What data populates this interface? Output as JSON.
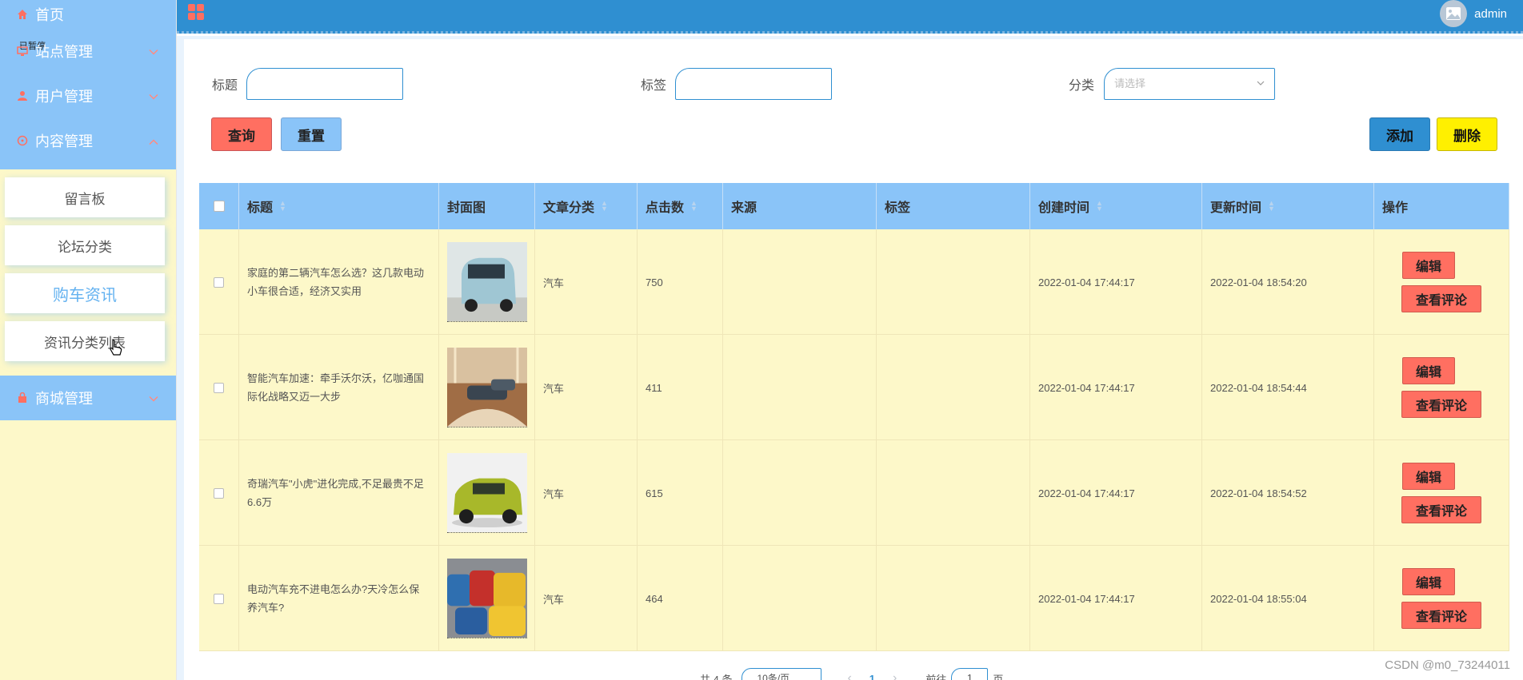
{
  "sidebar": {
    "home": "首页",
    "tooltip": "已暂停",
    "site_mgmt": "站点管理",
    "user_mgmt": "用户管理",
    "content_mgmt": "内容管理",
    "sub_items": [
      "留言板",
      "论坛分类",
      "购车资讯",
      "资讯分类列表"
    ],
    "active_sub": "购车资讯",
    "shop_mgmt": "商城管理"
  },
  "header": {
    "username": "admin"
  },
  "filters": {
    "title_label": "标题",
    "tag_label": "标签",
    "category_label": "分类",
    "category_placeholder": "请选择"
  },
  "buttons": {
    "query": "查询",
    "reset": "重置",
    "add": "添加",
    "delete": "删除"
  },
  "table": {
    "columns": [
      "标题",
      "封面图",
      "文章分类",
      "点击数",
      "来源",
      "标签",
      "创建时间",
      "更新时间",
      "操作"
    ],
    "rows": [
      {
        "title": "家庭的第二辆汽车怎么选？这几款电动小车很合适，经济又实用",
        "category": "汽车",
        "clicks": "750",
        "source": "",
        "tags": "",
        "created": "2022-01-04 17:44:17",
        "updated": "2022-01-04 18:54:20",
        "cover": "light-blue-minicar"
      },
      {
        "title": "智能汽车加速：牵手沃尔沃，亿咖通国际化战略又迈一大步",
        "category": "汽车",
        "clicks": "411",
        "source": "",
        "tags": "",
        "created": "2022-01-04 17:44:17",
        "updated": "2022-01-04 18:54:44",
        "cover": "showroom"
      },
      {
        "title": "奇瑞汽车\"小虎\"进化完成,不足最贵不足6.6万",
        "category": "汽车",
        "clicks": "615",
        "source": "",
        "tags": "",
        "created": "2022-01-04 17:44:17",
        "updated": "2022-01-04 18:54:52",
        "cover": "green-suv"
      },
      {
        "title": "电动汽车充不进电怎么办?天冷怎么保养汽车?",
        "category": "汽车",
        "clicks": "464",
        "source": "",
        "tags": "",
        "created": "2022-01-04 17:44:17",
        "updated": "2022-01-04 18:55:04",
        "cover": "parked-cars"
      }
    ],
    "edit_label": "编辑",
    "view_comments_label": "查看评论"
  },
  "pager": {
    "total": "共 4 条",
    "page_size": "10条/页",
    "current": "1",
    "goto": "前往",
    "goto_value": "1",
    "page_unit": "页"
  },
  "watermark": "CSDN @m0_73244011",
  "colors": {
    "header": "#2f8fd1",
    "sidebar_accent": "#8ac4f8",
    "sidebar_bg": "#fdf8c9",
    "danger": "#ff6f61",
    "warning": "#fff000"
  }
}
